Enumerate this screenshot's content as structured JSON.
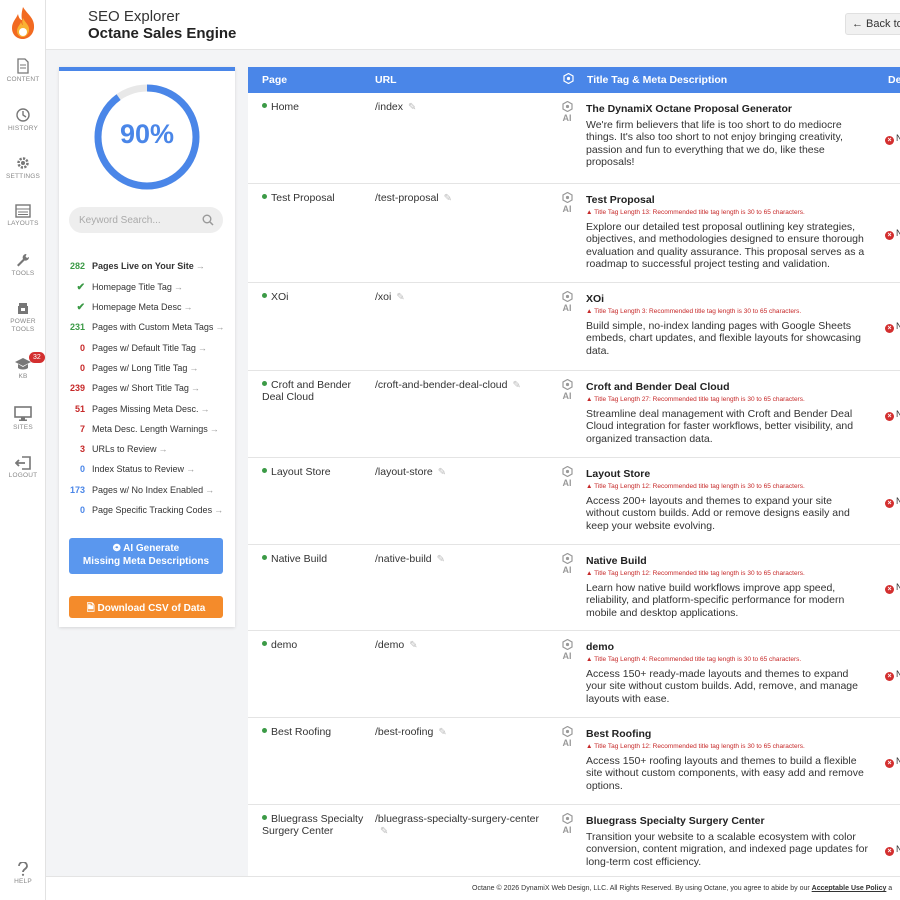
{
  "app": {
    "title": "SEO Explorer",
    "subtitle": "Octane Sales Engine",
    "back_label": "← Back to"
  },
  "rail": {
    "items": [
      {
        "label": "CONTENT",
        "icon": "document-icon"
      },
      {
        "label": "HISTORY",
        "icon": "history-icon"
      },
      {
        "label": "SETTINGS",
        "icon": "gear-icon"
      },
      {
        "label": "LAYOUTS",
        "icon": "layouts-icon"
      },
      {
        "label": "TOOLS",
        "icon": "wrench-icon"
      },
      {
        "label": "POWER TOOLS",
        "icon": "power-tools-icon"
      },
      {
        "label": "KB",
        "icon": "graduation-cap-icon",
        "badge": "32"
      },
      {
        "label": "SITES",
        "icon": "monitor-icon"
      },
      {
        "label": "LOGOUT",
        "icon": "logout-icon"
      },
      {
        "label": "HELP",
        "icon": "question-icon"
      }
    ]
  },
  "stats": {
    "score": "90%",
    "score_fraction": 0.9,
    "search_placeholder": "Keyword Search...",
    "items": [
      {
        "value": "282",
        "label": "Pages Live on Your Site",
        "color": "green",
        "bold": true
      },
      {
        "value": "✔",
        "label": "Homepage Title Tag",
        "color": "check"
      },
      {
        "value": "✔",
        "label": "Homepage Meta Desc",
        "color": "check"
      },
      {
        "value": "231",
        "label": "Pages with Custom Meta Tags",
        "color": "green"
      },
      {
        "value": "0",
        "label": "Pages w/ Default Title Tag",
        "color": "red"
      },
      {
        "value": "0",
        "label": "Pages w/ Long Title Tag",
        "color": "red"
      },
      {
        "value": "239",
        "label": "Pages w/ Short Title Tag",
        "color": "red"
      },
      {
        "value": "51",
        "label": "Pages Missing Meta Desc.",
        "color": "red"
      },
      {
        "value": "7",
        "label": "Meta Desc. Length Warnings",
        "color": "red"
      },
      {
        "value": "3",
        "label": "URLs to Review",
        "color": "red"
      },
      {
        "value": "0",
        "label": "Index Status to Review",
        "color": "blue"
      },
      {
        "value": "173",
        "label": "Pages w/ No Index Enabled",
        "color": "blue"
      },
      {
        "value": "0",
        "label": "Page Specific Tracking Codes",
        "color": "blue"
      }
    ],
    "ai_button_line1": "AI Generate",
    "ai_button_line2": "Missing Meta Descriptions",
    "csv_button": "Download CSV of Data"
  },
  "table": {
    "headers": {
      "page": "Page",
      "url": "URL",
      "meta": "Title Tag & Meta Description",
      "status": "De"
    },
    "rows": [
      {
        "page": "Home",
        "url": "/index",
        "ai": "AI",
        "title": "The DynamiX Octane Proposal Generator",
        "warning": "",
        "desc": "We're firm believers that life is too short to do mediocre things. It's also too short to not enjoy bringing creativity, passion and fun to everything that we do, like these proposals!",
        "status": "N"
      },
      {
        "page": "Test Proposal",
        "url": "/test-proposal",
        "ai": "AI",
        "title": "Test Proposal",
        "warning": "▲ Title Tag Length 13: Recommended title tag length is 30 to 65 characters.",
        "desc": "Explore our detailed test proposal outlining key strategies, objectives, and methodologies designed to ensure thorough evaluation and quality assurance. This proposal serves as a roadmap to successful project testing and validation.",
        "status": "N"
      },
      {
        "page": "XOi",
        "url": "/xoi",
        "ai": "AI",
        "title": "XOi",
        "warning": "▲ Title Tag Length 3: Recommended title tag length is 30 to 65 characters.",
        "desc": "Build simple, no-index landing pages with Google Sheets embeds, chart updates, and flexible layouts for showcasing data.",
        "status": "N"
      },
      {
        "page": "Croft and Bender Deal Cloud",
        "url": "/croft-and-bender-deal-cloud",
        "ai": "AI",
        "title": "Croft and Bender Deal Cloud",
        "warning": "▲ Title Tag Length 27: Recommended title tag length is 30 to 65 characters.",
        "desc": "Streamline deal management with Croft and Bender Deal Cloud integration for faster workflows, better visibility, and organized transaction data.",
        "status": "N"
      },
      {
        "page": "Layout Store",
        "url": "/layout-store",
        "ai": "AI",
        "title": "Layout Store",
        "warning": "▲ Title Tag Length 12: Recommended title tag length is 30 to 65 characters.",
        "desc": "Access 200+ layouts and themes to expand your site without custom builds. Add or remove designs easily and keep your website evolving.",
        "status": "N"
      },
      {
        "page": "Native Build",
        "url": "/native-build",
        "ai": "AI",
        "title": "Native Build",
        "warning": "▲ Title Tag Length 12: Recommended title tag length is 30 to 65 characters.",
        "desc": "Learn how native build workflows improve app speed, reliability, and platform-specific performance for modern mobile and desktop applications.",
        "status": "N"
      },
      {
        "page": "demo",
        "url": "/demo",
        "ai": "AI",
        "title": "demo",
        "warning": "▲ Title Tag Length 4: Recommended title tag length is 30 to 65 characters.",
        "desc": "Access 150+ ready-made layouts and themes to expand your site without custom builds. Add, remove, and manage layouts with ease.",
        "status": "N"
      },
      {
        "page": "Best Roofing",
        "url": "/best-roofing",
        "ai": "AI",
        "title": "Best Roofing",
        "warning": "▲ Title Tag Length 12: Recommended title tag length is 30 to 65 characters.",
        "desc": "Access 150+ roofing layouts and themes to build a flexible site without custom components, with easy add and remove options.",
        "status": "N"
      },
      {
        "page": "Bluegrass Specialty Surgery Center",
        "url": "/bluegrass-specialty-surgery-center",
        "ai": "AI",
        "title": "Bluegrass Specialty Surgery Center",
        "warning": "",
        "desc": "Transition your website to a scalable ecosystem with color conversion, content migration, and indexed page updates for long-term cost efficiency.",
        "status": "N"
      }
    ]
  },
  "footer": {
    "text": "Octane © 2026 DynamiX Web Design, LLC. All Rights Reserved. By using Octane, you agree to abide by our ",
    "link": "Acceptable Use Policy",
    "tail": " a"
  },
  "colors": {
    "accent": "#4a86e8",
    "orange": "#f48b2b",
    "green": "#3b9a46",
    "red": "#c62828"
  }
}
